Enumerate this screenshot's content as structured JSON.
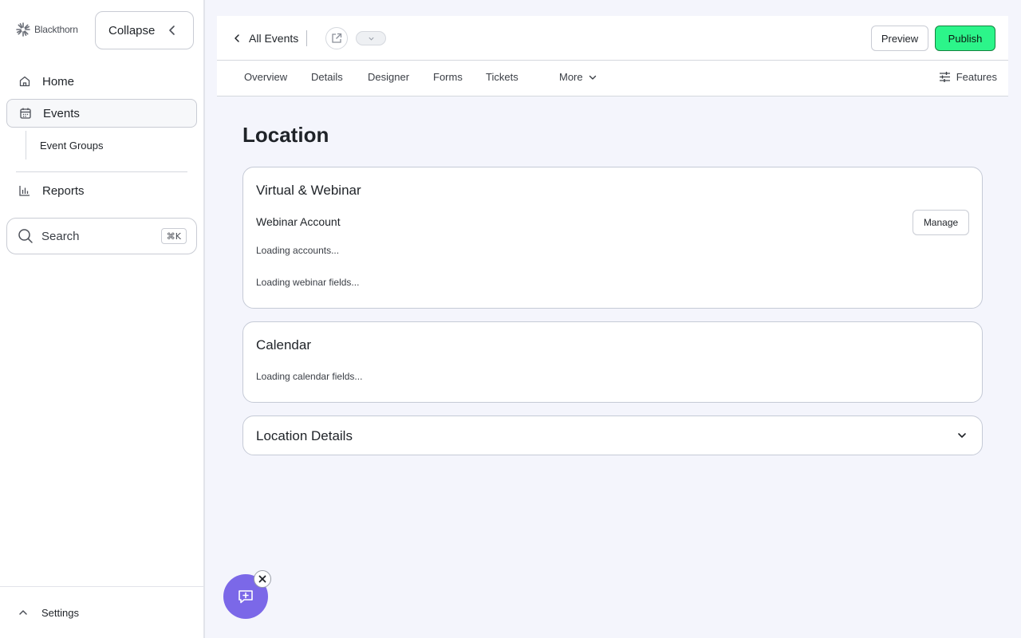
{
  "sidebar": {
    "logo_text": "Blackthorn",
    "collapse_label": "Collapse",
    "nav": {
      "home": "Home",
      "events": "Events",
      "event_groups": "Event Groups",
      "reports": "Reports"
    },
    "search": {
      "placeholder": "Search",
      "shortcut": "⌘K"
    },
    "settings_label": "Settings"
  },
  "header": {
    "back_label": "All Events",
    "preview_label": "Preview",
    "publish_label": "Publish",
    "colors": {
      "publish_bg": "#2cf58a",
      "accent": "#7b68e8"
    }
  },
  "tabs": {
    "overview": "Overview",
    "details": "Details",
    "designer": "Designer",
    "forms": "Forms",
    "tickets": "Tickets",
    "more": "More",
    "features": "Features"
  },
  "main": {
    "page_title": "Location",
    "virtual_card": {
      "title": "Virtual & Webinar",
      "subtitle": "Webinar Account",
      "manage_label": "Manage",
      "loading_accounts": "Loading accounts...",
      "loading_fields": "Loading webinar fields..."
    },
    "calendar_card": {
      "title": "Calendar",
      "loading": "Loading calendar fields..."
    },
    "location_card": {
      "title": "Location Details"
    }
  },
  "icons": {
    "home": "home-icon",
    "events": "calendar-icon",
    "reports": "bar-chart-icon",
    "search": "search-icon",
    "chat": "message-plus-icon"
  }
}
